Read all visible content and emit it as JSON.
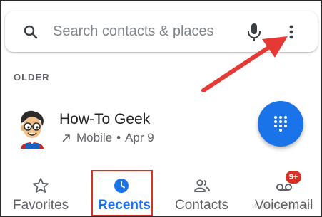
{
  "search": {
    "placeholder": "Search contacts & places",
    "icon": "search-icon",
    "mic_icon": "microphone-icon",
    "more_icon": "more-vertical-icon"
  },
  "section": {
    "label": "OLDER"
  },
  "calls": [
    {
      "name": "How-To Geek",
      "direction_icon": "outgoing-call-icon",
      "type": "Mobile",
      "separator": "•",
      "date": "Apr 9"
    }
  ],
  "fab": {
    "icon": "dialpad-icon",
    "color": "#1a73e8"
  },
  "bottom_nav": {
    "items": [
      {
        "label": "Favorites",
        "icon": "star-icon",
        "selected": false
      },
      {
        "label": "Recents",
        "icon": "clock-icon",
        "selected": true
      },
      {
        "label": "Contacts",
        "icon": "people-icon",
        "selected": false
      },
      {
        "label": "Voicemail",
        "icon": "voicemail-icon",
        "selected": false,
        "badge": "9+"
      }
    ]
  },
  "annotation": {
    "color": "#e53935"
  },
  "watermark": "www.989214.com",
  "colors": {
    "accent": "#1a73e8",
    "highlight": "#d93025",
    "text_secondary": "#5f6368"
  }
}
